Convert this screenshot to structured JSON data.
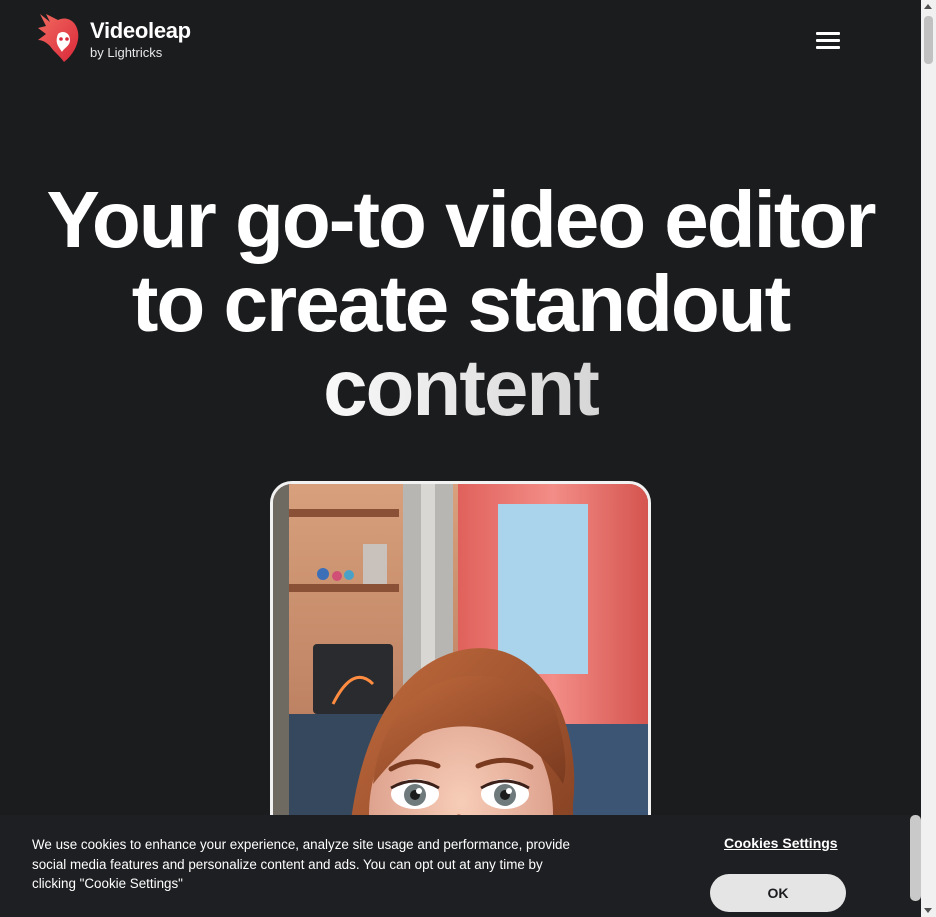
{
  "brand": {
    "name": "Videoleap",
    "sub": "by Lightricks",
    "accent": "#e8474c"
  },
  "header": {
    "menu_icon": "hamburger-menu-icon"
  },
  "hero": {
    "line1": "Your go-to video editor",
    "line2": "to create standout",
    "line3": "content"
  },
  "cookie": {
    "text": "We use cookies to enhance your experience, analyze site usage and performance, provide social media features and personalize content and ads. You can opt out at any time by clicking \"Cookie Settings\"",
    "settings_label": "Cookies Settings",
    "ok_label": "OK"
  },
  "colors": {
    "background": "#1b1c1e",
    "button": "#e5e5e5"
  }
}
